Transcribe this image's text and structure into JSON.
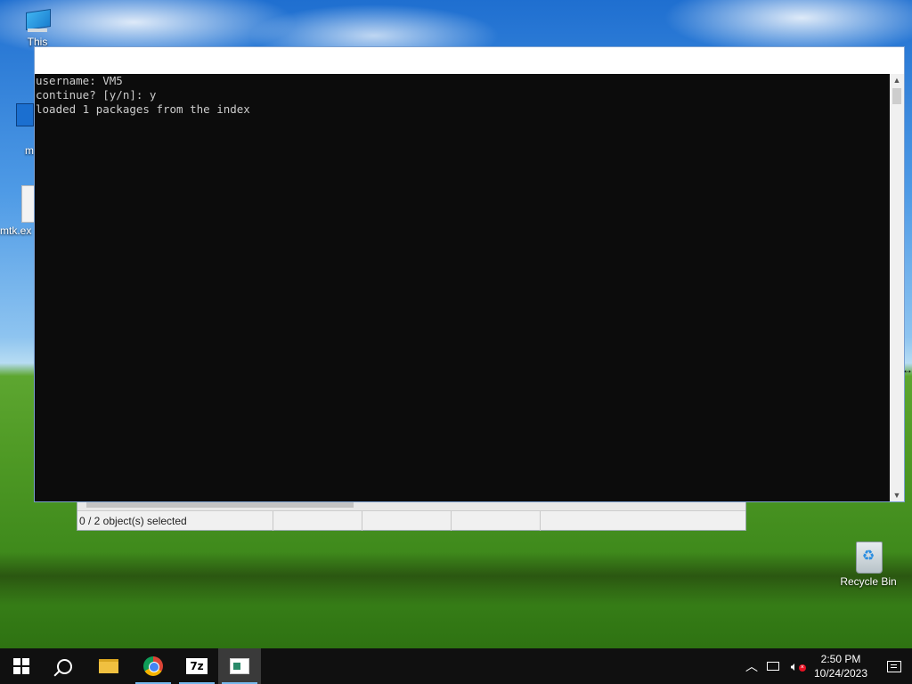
{
  "desktop": {
    "icons": [
      {
        "label": "This"
      },
      {
        "label": "m"
      },
      {
        "label": "mtk.ex"
      },
      {
        "label": "Recycle Bin"
      }
    ]
  },
  "background_window": {
    "status_selected": "0 / 2 object(s) selected"
  },
  "console": {
    "lines": [
      "username: VM5",
      "continue? [y/n]: y",
      "loaded 1 packages from the index"
    ]
  },
  "taskbar": {
    "buttons": [
      {
        "icon": "windows-start-icon"
      },
      {
        "icon": "search-icon"
      },
      {
        "icon": "file-explorer-icon"
      },
      {
        "icon": "chrome-icon"
      },
      {
        "icon": "7zip-icon",
        "label": "7z"
      },
      {
        "icon": "console-app-icon"
      }
    ],
    "tray": {
      "time": "2:50 PM",
      "date": "10/24/2023"
    }
  },
  "colors": {
    "console_bg": "#0c0c0c",
    "console_text": "#cccccc",
    "taskbar_bg": "#101010",
    "active_underline": "#76b9ed"
  }
}
